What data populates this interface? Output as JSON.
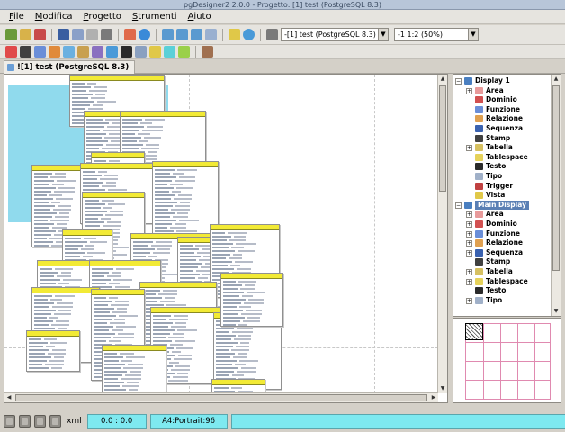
{
  "window": {
    "title": "pgDesigner2 2.0.0 - Progetto: [1] test (PostgreSQL 8.3)"
  },
  "menu": {
    "items": [
      {
        "label": "File",
        "mnemonic": "F",
        "rest": "ile"
      },
      {
        "label": "Modifica",
        "mnemonic": "M",
        "rest": "odifica"
      },
      {
        "label": "Progetto",
        "mnemonic": "P",
        "rest": "rogetto"
      },
      {
        "label": "Strumenti",
        "mnemonic": "S",
        "rest": "trumenti"
      },
      {
        "label": "Aiuto",
        "mnemonic": "A",
        "rest": "iuto"
      }
    ]
  },
  "toolbar": {
    "project_combo": "-[1] test (PostgreSQL 8.3)",
    "zoom_combo": "-1 1:2 (50%)"
  },
  "tabs": [
    {
      "label": "![1] test (PostgreSQL 8.3)"
    }
  ],
  "tree": {
    "items": [
      {
        "label": "Display 1",
        "level": 0,
        "expander": "−",
        "icon": "display-icon",
        "color": "#4a7fc0"
      },
      {
        "label": "Area",
        "level": 1,
        "expander": "+",
        "icon": "area-icon",
        "color": "#e89a9a"
      },
      {
        "label": "Dominio",
        "level": 1,
        "expander": "",
        "icon": "domain-icon",
        "color": "#d25050"
      },
      {
        "label": "Funzione",
        "level": 1,
        "expander": "",
        "icon": "function-icon",
        "color": "#6a8ed8"
      },
      {
        "label": "Relazione",
        "level": 1,
        "expander": "",
        "icon": "relation-icon",
        "color": "#e0a050"
      },
      {
        "label": "Sequenza",
        "level": 1,
        "expander": "",
        "icon": "sequence-icon",
        "color": "#3a62b0"
      },
      {
        "label": "Stamp",
        "level": 1,
        "expander": "",
        "icon": "stamp-icon",
        "color": "#404040"
      },
      {
        "label": "Tabella",
        "level": 1,
        "expander": "+",
        "icon": "table-icon",
        "color": "#d6c060"
      },
      {
        "label": "Tablespace",
        "level": 1,
        "expander": "",
        "icon": "tablespace-icon",
        "color": "#e6d25a"
      },
      {
        "label": "Testo",
        "level": 1,
        "expander": "",
        "icon": "text-icon",
        "color": "#2a2a2a"
      },
      {
        "label": "Tipo",
        "level": 1,
        "expander": "",
        "icon": "type-icon",
        "color": "#a0b0c8"
      },
      {
        "label": "Trigger",
        "level": 1,
        "expander": "",
        "icon": "trigger-icon",
        "color": "#c04040"
      },
      {
        "label": "Vista",
        "level": 1,
        "expander": "",
        "icon": "view-icon",
        "color": "#e0c848"
      },
      {
        "label": "Main Display",
        "level": 0,
        "expander": "−",
        "icon": "display-icon",
        "color": "#4a7fc0",
        "selected": true
      },
      {
        "label": "Area",
        "level": 1,
        "expander": "+",
        "icon": "area-icon",
        "color": "#e89a9a"
      },
      {
        "label": "Dominio",
        "level": 1,
        "expander": "+",
        "icon": "domain-icon",
        "color": "#d25050"
      },
      {
        "label": "Funzione",
        "level": 1,
        "expander": "+",
        "icon": "function-icon",
        "color": "#6a8ed8"
      },
      {
        "label": "Relazione",
        "level": 1,
        "expander": "+",
        "icon": "relation-icon",
        "color": "#e0a050"
      },
      {
        "label": "Sequenza",
        "level": 1,
        "expander": "+",
        "icon": "sequence-icon",
        "color": "#3a62b0"
      },
      {
        "label": "Stamp",
        "level": 1,
        "expander": "",
        "icon": "stamp-icon",
        "color": "#404040"
      },
      {
        "label": "Tabella",
        "level": 1,
        "expander": "+",
        "icon": "table-icon",
        "color": "#d6c060"
      },
      {
        "label": "Tablespace",
        "level": 1,
        "expander": "+",
        "icon": "tablespace-icon",
        "color": "#e6d25a"
      },
      {
        "label": "Testo",
        "level": 1,
        "expander": "",
        "icon": "text-icon",
        "color": "#2a2a2a"
      },
      {
        "label": "Tipo",
        "level": 1,
        "expander": "+",
        "icon": "type-icon",
        "color": "#a0b0c8"
      }
    ]
  },
  "statusbar": {
    "mode_label": "xml",
    "coords": "0.0 : 0.0",
    "page_format": "A4:Portrait:96"
  },
  "colors": {
    "table_header": "#f2ea35",
    "selection": "#5a7fb4",
    "status_field": "#7ee9f0",
    "area_fill": "#7dd3ea"
  }
}
